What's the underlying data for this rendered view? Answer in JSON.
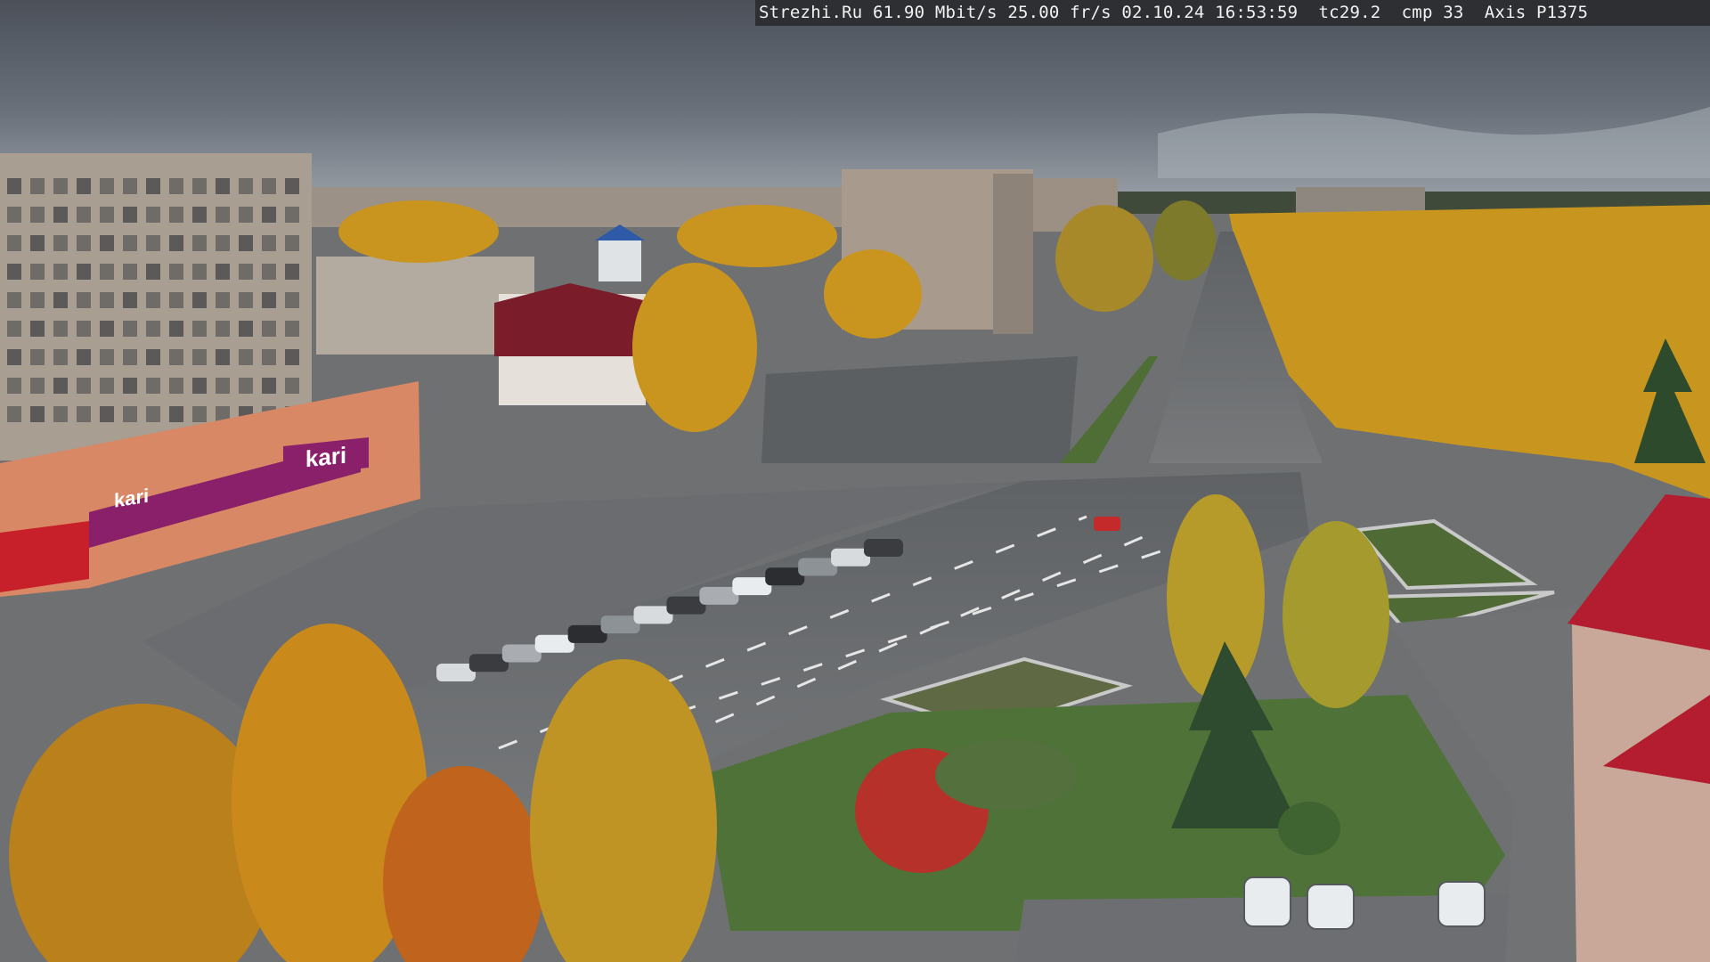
{
  "osd": {
    "site": "Strezhi.Ru",
    "bitrate": "61.90 Mbit/s",
    "framerate": "25.00 fr/s",
    "date": "02.10.24",
    "time": "16:53:59",
    "tc": "tc29.2",
    "cmp": "cmp 33",
    "camera": "Axis P1375"
  },
  "signs": {
    "store_main": "kari",
    "store_side": "kari"
  },
  "colors": {
    "sky": "#5d636d",
    "asphalt": "#6b6d70",
    "foliage_yellow": "#d29a1e",
    "grass": "#5a7a3a",
    "brand": "#8a1f6a"
  }
}
